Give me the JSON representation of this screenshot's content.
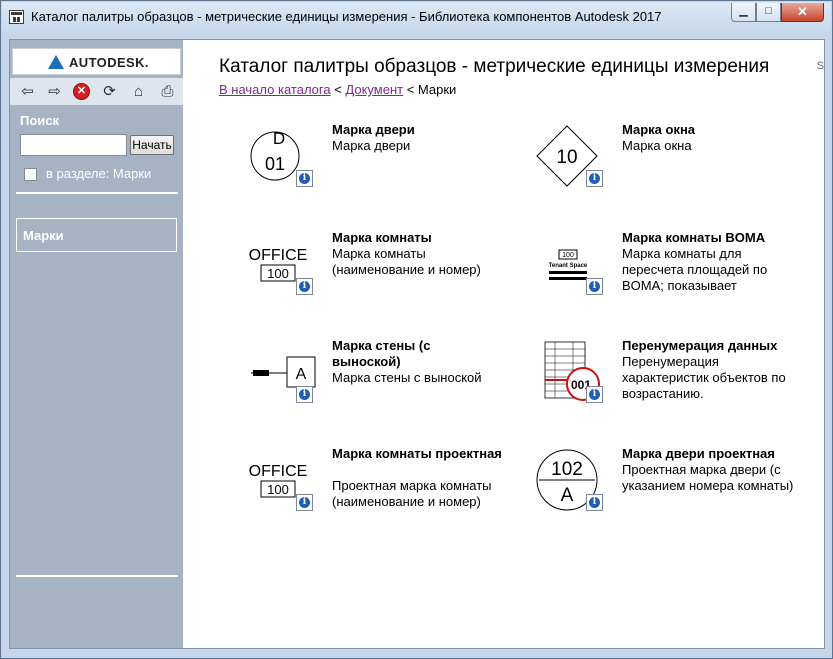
{
  "window": {
    "title": "Каталог палитры образцов - метрические единицы измерения - Библиотека компонентов Autodesk 2017",
    "min_label": "▁",
    "max_label": "□",
    "close_label": "✕"
  },
  "sidebar": {
    "logo_text": "AUTODESK.",
    "nav": {
      "back": "⇦",
      "forward": "⇨",
      "stop": "✕",
      "refresh": "⟳",
      "home": "⌂",
      "print": "⎙"
    },
    "search_label": "Поиск",
    "search_value": "",
    "search_button": "Начать",
    "scope_label": "в разделе: Марки",
    "scope_checked": false,
    "selected_item": "Марки"
  },
  "main": {
    "title": "Каталог палитры образцов - метрические единицы измерения",
    "breadcrumb": {
      "home": "В начало каталога",
      "sep1": " < ",
      "doc": "Документ",
      "sep2": " < ",
      "current": "Марки"
    },
    "items": [
      {
        "title": "Марка двери",
        "desc": "Марка двери",
        "thumb_top": "D",
        "thumb_main": "01"
      },
      {
        "title": "Марка окна",
        "desc": "Марка окна",
        "thumb_main": "10"
      },
      {
        "title": "Марка комнаты",
        "desc": "Марка комнаты (наименование и номер)",
        "thumb_top": "OFFICE",
        "thumb_main": "100"
      },
      {
        "title": "Марка комнаты BOMA",
        "desc": "Марка комнаты для пересчета площадей по BOMA; показывает",
        "thumb_top": "100",
        "thumb_main": "Tenant Space"
      },
      {
        "title": "Марка стены (с выноской)",
        "desc": "Марка стены с выноской",
        "thumb_main": "A"
      },
      {
        "title": "Перенумерация данных",
        "desc": "Перенумерация характеристик объектов по возрастанию.",
        "thumb_main": "001"
      },
      {
        "title": "Марка комнаты проектная",
        "desc": "Проектная марка комнаты (наименование и номер)",
        "thumb_top": "OFFICE",
        "thumb_main": "100"
      },
      {
        "title": "Марка двери проектная",
        "desc": "Проектная марка двери (с указанием номера комнаты)",
        "thumb_top": "102",
        "thumb_main": "A"
      }
    ]
  }
}
